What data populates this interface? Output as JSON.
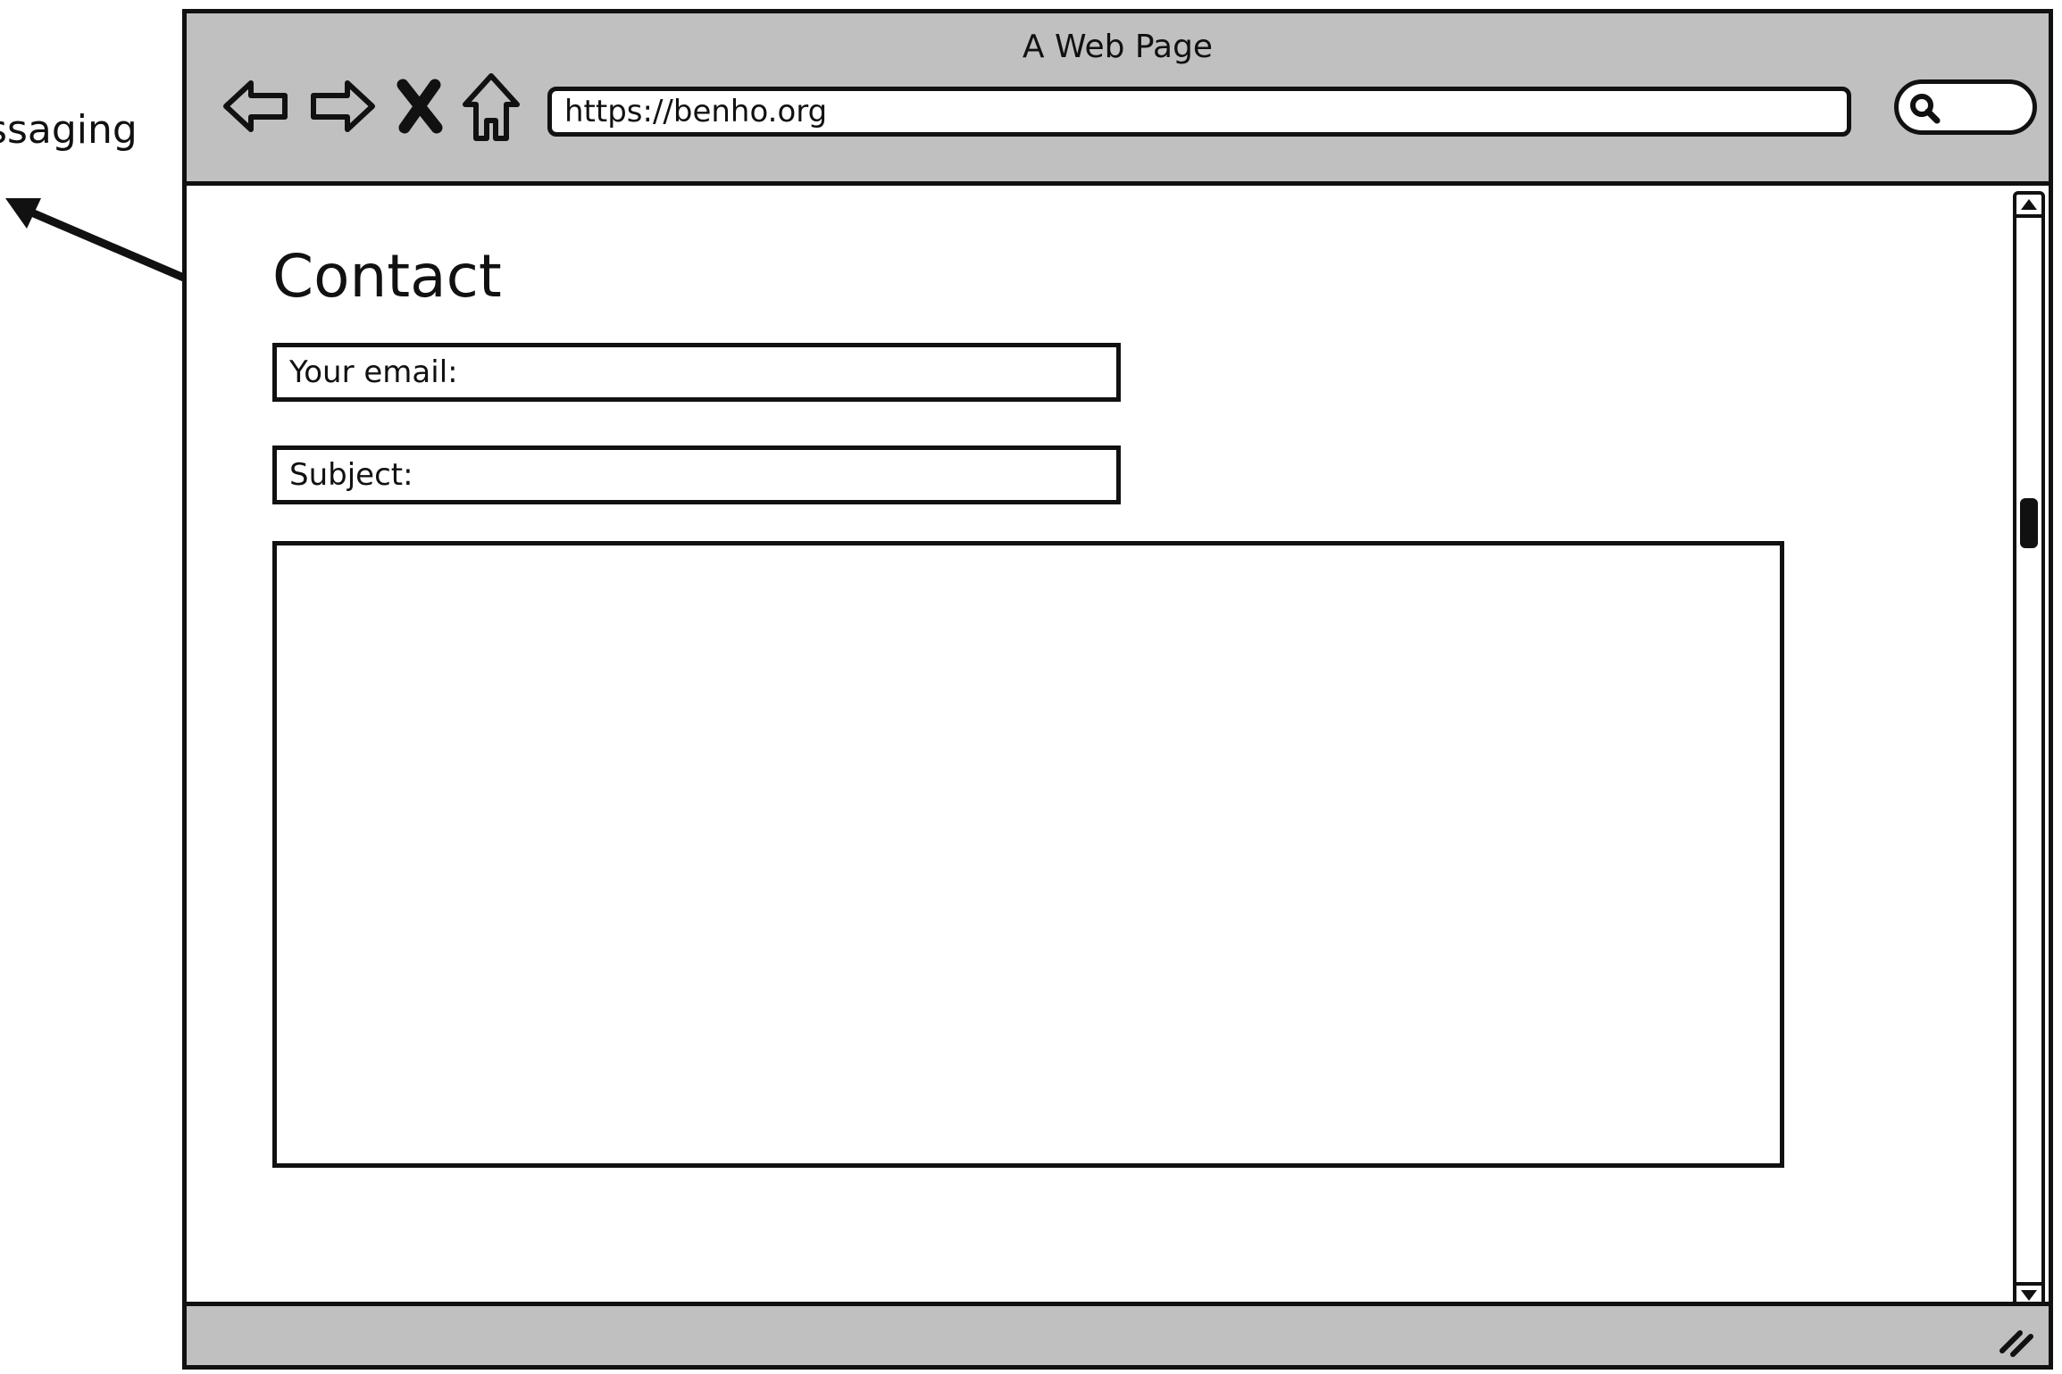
{
  "annotation": {
    "label": "essaging"
  },
  "window": {
    "title": "A Web Page"
  },
  "toolbar": {
    "back_icon": "back-arrow-icon",
    "forward_icon": "forward-arrow-icon",
    "stop_icon": "close-icon",
    "home_icon": "home-icon",
    "url": "https://benho.org",
    "search_icon": "search-icon"
  },
  "page": {
    "title": "Contact",
    "email_field": {
      "label": "Your email:"
    },
    "subject_field": {
      "label": "Subject:"
    },
    "message_area": {
      "value": ""
    }
  },
  "colors": {
    "chrome": "#c0c0c0",
    "stroke": "#111111",
    "background": "#ffffff"
  }
}
